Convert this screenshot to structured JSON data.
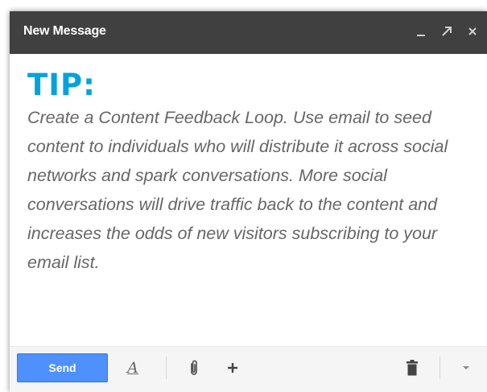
{
  "compose": {
    "title": "New Message",
    "controls": {
      "minimize_icon": "minimize-icon",
      "popout_icon": "popout-arrow-icon",
      "close_icon": "close-icon"
    },
    "tip_heading": "TIP:",
    "tip_body": "Create a Content Feedback Loop. Use email to seed content to individuals who will distribute it across social networks and spark conversations. More social conversations will drive traffic back to the content and increases the odds of new visitors subscribing to your email list."
  },
  "toolbar": {
    "send_label": "Send",
    "format_label": "A"
  },
  "colors": {
    "titlebar": "#404040",
    "tip_accent": "#00a3de",
    "send_button": "#4d90fe",
    "body_text": "#666666"
  }
}
